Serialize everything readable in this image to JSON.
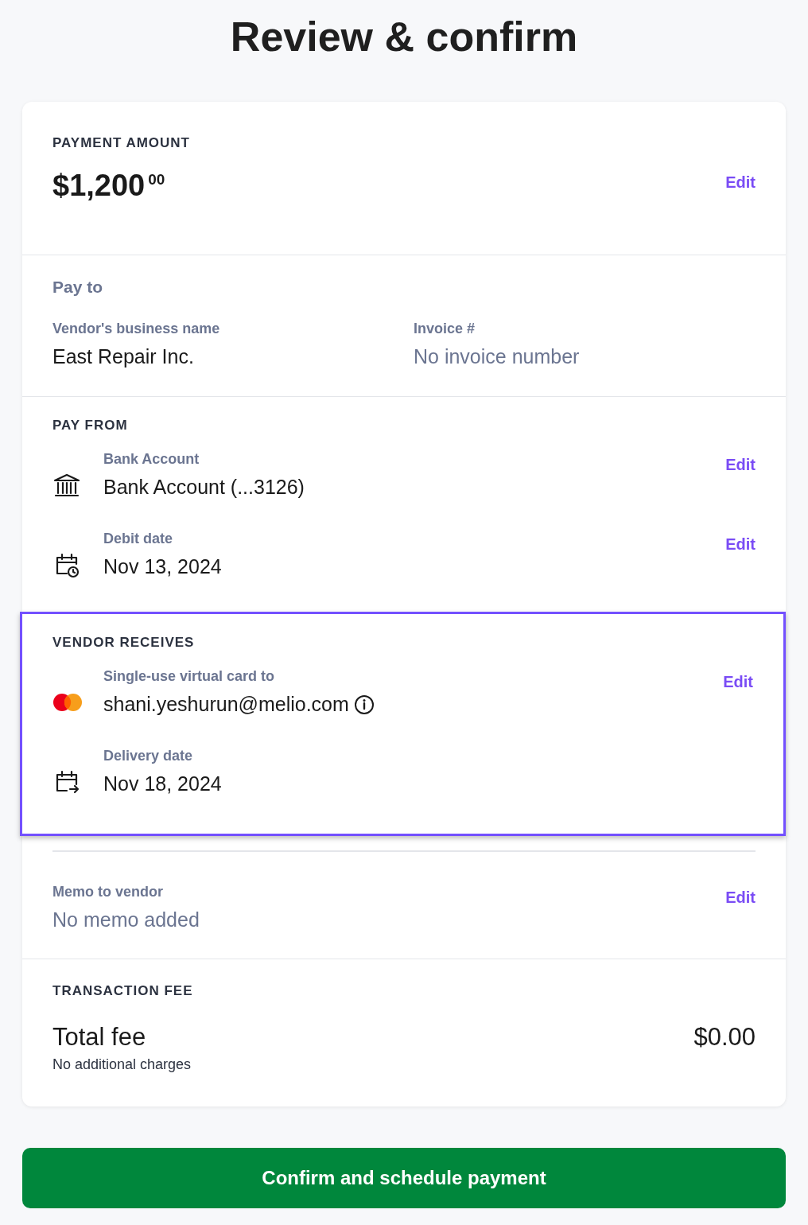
{
  "title": "Review & confirm",
  "payment_amount": {
    "heading": "PAYMENT AMOUNT",
    "amount": "$1,200",
    "cents": "00",
    "edit": "Edit"
  },
  "pay_to": {
    "heading": "Pay to",
    "fields": [
      {
        "label": "Vendor's business name",
        "value": "East Repair Inc.",
        "muted": false
      },
      {
        "label": "Invoice #",
        "value": "No invoice number",
        "muted": true
      }
    ]
  },
  "sections": [
    {
      "heading": "PAY FROM",
      "items": [
        {
          "kind": "bank",
          "label": "Bank Account",
          "value": "Bank Account (...3126)",
          "edit": "Edit"
        },
        {
          "kind": "calendar-clock",
          "label": "Debit date",
          "value": "Nov 13, 2024",
          "edit": "Edit"
        }
      ]
    },
    {
      "heading": "VENDOR RECEIVES",
      "highlighted": true,
      "items": [
        {
          "kind": "card",
          "label": "Single-use virtual card to",
          "value": "shani.yeshurun@melio.com",
          "info": true,
          "edit": "Edit"
        },
        {
          "kind": "calendar-arrow",
          "label": "Delivery date",
          "value": "Nov 18, 2024"
        }
      ]
    }
  ],
  "memo": {
    "label": "Memo to vendor",
    "value": "No memo added",
    "muted": true,
    "edit": "Edit"
  },
  "fee": {
    "heading": "TRANSACTION FEE",
    "label": "Total fee",
    "note": "No additional charges",
    "amount": "$0.00"
  },
  "confirm_button": "Confirm and schedule payment"
}
